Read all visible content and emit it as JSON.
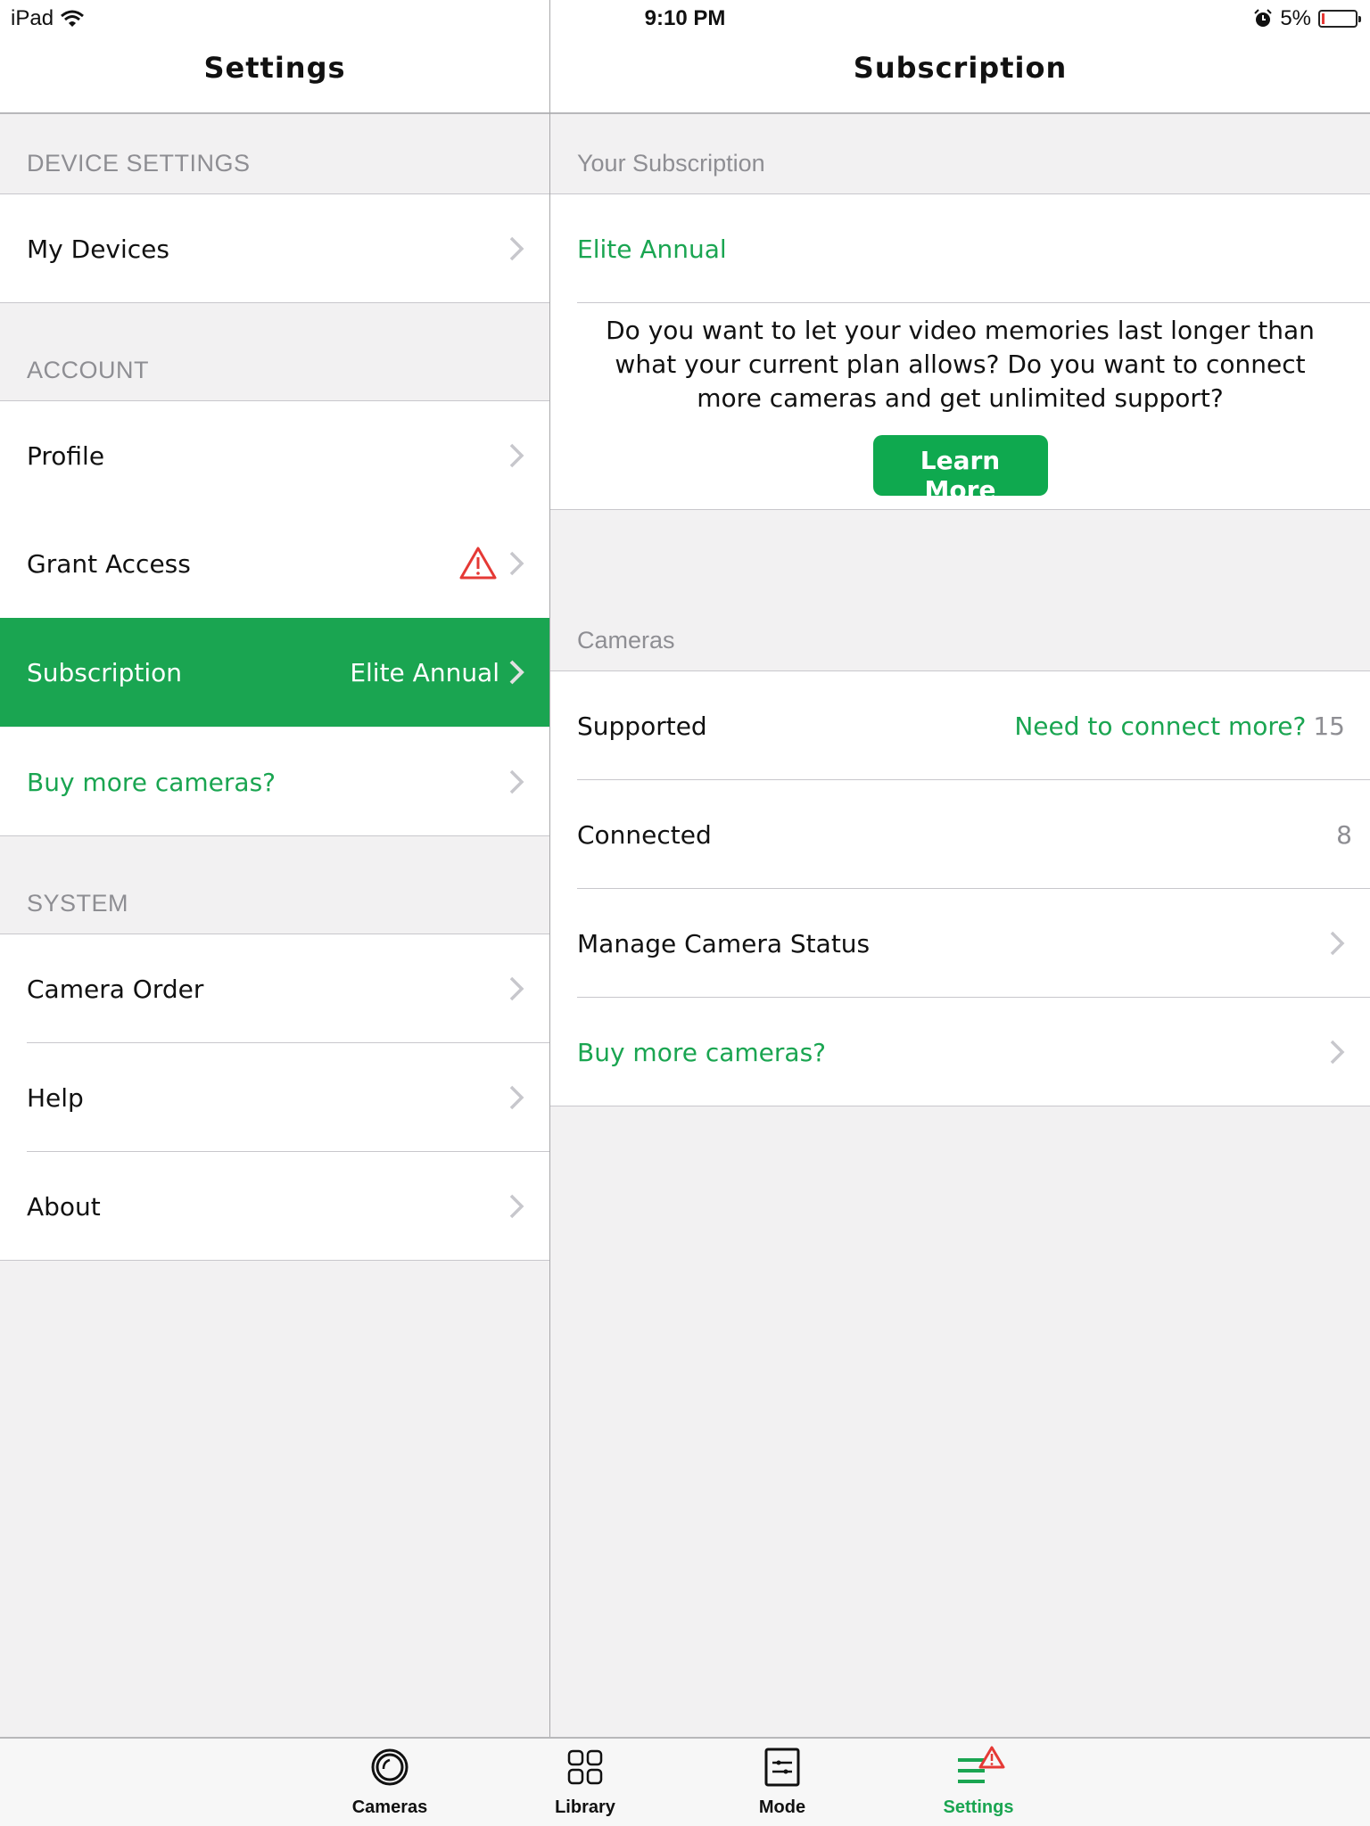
{
  "status_bar": {
    "device": "iPad",
    "time": "9:10 PM",
    "battery_percent_label": "5%",
    "battery_level": 0.05
  },
  "colors": {
    "accent_green": "#1aa551",
    "warning_red": "#e53935",
    "section_gray": "#8e8e93"
  },
  "left": {
    "title": "Settings",
    "sections": [
      {
        "header": "DEVICE SETTINGS",
        "items": [
          {
            "label": "My Devices"
          }
        ]
      },
      {
        "header": "ACCOUNT",
        "items": [
          {
            "label": "Profile"
          },
          {
            "label": "Grant Access",
            "icon": "warning-icon"
          },
          {
            "label": "Subscription",
            "value": "Elite Annual",
            "selected": true
          },
          {
            "label": "Buy more cameras?",
            "style": "green-link"
          }
        ]
      },
      {
        "header": "SYSTEM",
        "items": [
          {
            "label": "Camera Order"
          },
          {
            "label": "Help"
          },
          {
            "label": "About"
          }
        ]
      }
    ]
  },
  "right": {
    "title": "Subscription",
    "your_subscription": {
      "header": "Your Subscription",
      "plan": "Elite Annual",
      "promo_text": "Do you want to let your video memories last longer than what your current plan allows? Do you want to connect more cameras and get unlimited support?",
      "learn_more_label": "Learn More"
    },
    "cameras": {
      "header": "Cameras",
      "supported_label": "Supported",
      "supported_link": "Need to connect more?",
      "supported_value": "15",
      "connected_label": "Connected",
      "connected_value": "8",
      "manage_label": "Manage Camera Status",
      "buy_label": "Buy more cameras?"
    }
  },
  "tabbar": {
    "tabs": [
      {
        "label": "Cameras",
        "icon": "camera-lens-icon"
      },
      {
        "label": "Library",
        "icon": "grid-icon"
      },
      {
        "label": "Mode",
        "icon": "sliders-icon"
      },
      {
        "label": "Settings",
        "icon": "menu-warning-icon",
        "active": true
      }
    ]
  }
}
